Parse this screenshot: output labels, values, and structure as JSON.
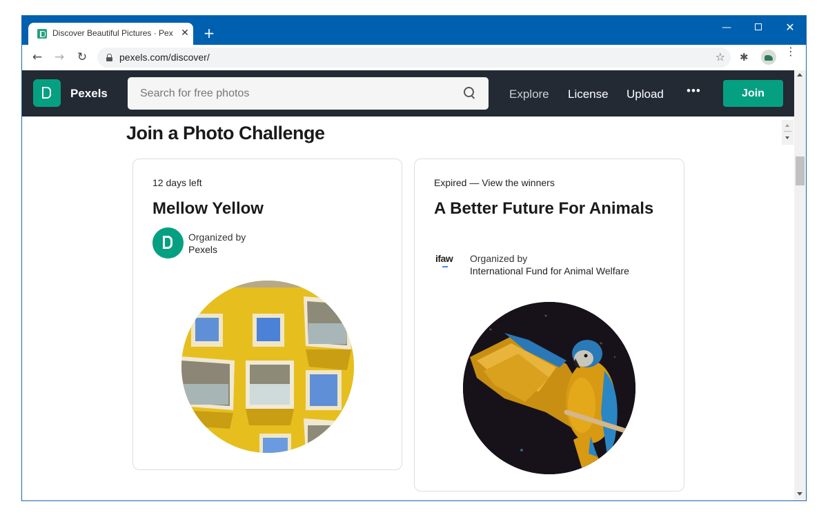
{
  "browser": {
    "tab_title": "Discover Beautiful Pictures · Pexels",
    "tab_close": "✕",
    "new_tab": "+",
    "url": "pexels.com/discover/",
    "window_controls": {
      "minimize": "—",
      "close": "✕"
    },
    "nav": {
      "back": "←",
      "forward": "→",
      "reload": "↻"
    },
    "star": "☆",
    "extensions": "✱",
    "menu": "⋮"
  },
  "pexels_nav": {
    "brand": "Pexels",
    "search_placeholder": "Search for free photos",
    "search_value": "",
    "links": [
      "Explore",
      "License",
      "Upload"
    ],
    "more": "•••",
    "join": "Join"
  },
  "section": {
    "title": "Join a Photo Challenge"
  },
  "challenges": [
    {
      "status": "12 days left",
      "title": "Mellow Yellow",
      "organized_label": "Organized by",
      "organizer": "Pexels",
      "organizer_logo": "pexels-logo",
      "image": "yellow-building-balconies"
    },
    {
      "status": "Expired — View the winners",
      "title": "A Better Future For Animals",
      "organized_label": "Organized by",
      "organizer": "International Fund for Animal Welfare",
      "organizer_logo": "ifaw",
      "image": "macaw-parrot-on-perch"
    }
  ],
  "colors": {
    "titlebar": "#0060b0",
    "pexels_nav_bg": "#232a34",
    "brand_green": "#05a081"
  }
}
